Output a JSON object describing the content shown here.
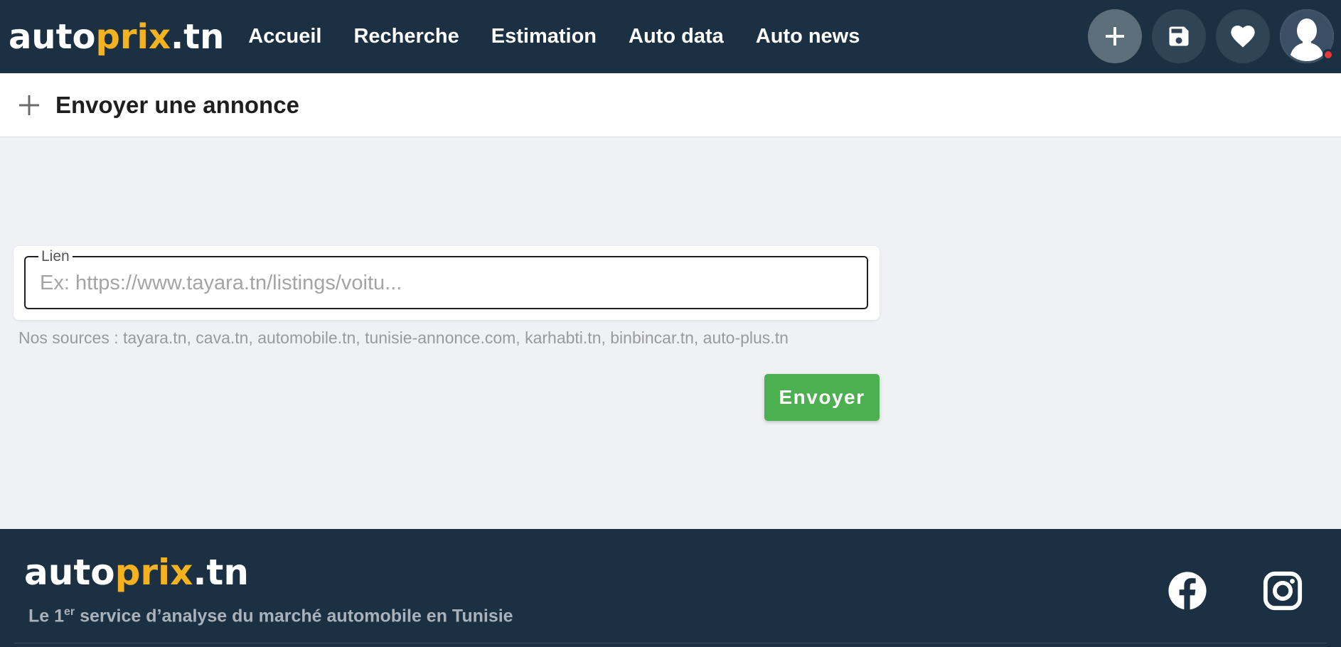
{
  "header": {
    "logo": {
      "part1": "auto",
      "part2": "prix",
      "part3": ".tn"
    },
    "nav": [
      "Accueil",
      "Recherche",
      "Estimation",
      "Auto data",
      "Auto news"
    ],
    "actions": [
      "plus-icon",
      "save-icon",
      "heart-icon",
      "user-avatar"
    ],
    "colors": {
      "navbar_bg": "#1b3042",
      "brand_accent": "#f5b21f",
      "notification_dot": "#e53935"
    }
  },
  "section": {
    "title": "Envoyer une annonce",
    "icon": "plus-icon"
  },
  "form": {
    "link_label": "Lien",
    "link_placeholder": "Ex: https://www.tayara.tn/listings/voitu...",
    "link_value": "",
    "sources_text": "Nos sources : tayara.tn, cava.tn, automobile.tn, tunisie-annonce.com, karhabti.tn, binbincar.tn, auto-plus.tn",
    "submit_label": "Envoyer",
    "submit_color": "#4caf50"
  },
  "footer": {
    "logo": {
      "part1": "auto",
      "part2": "prix",
      "part3": ".tn"
    },
    "tagline_prefix": "Le 1",
    "tagline_sup": "er",
    "tagline_rest": " service d’analyse du marché automobile en Tunisie",
    "social": [
      "facebook-icon",
      "instagram-icon"
    ]
  }
}
